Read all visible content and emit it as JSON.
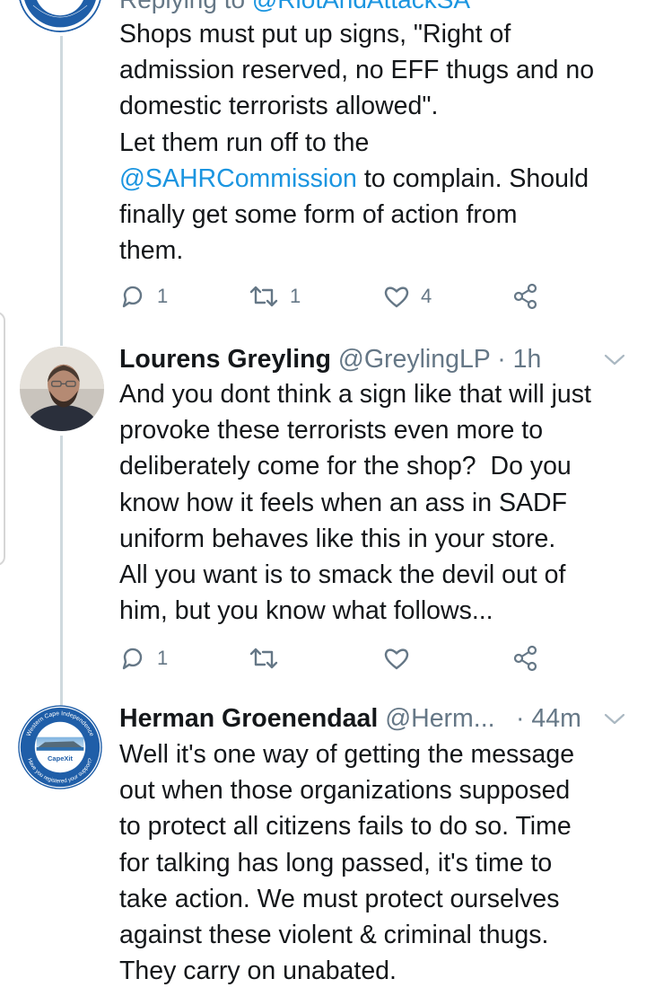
{
  "tweets": [
    {
      "reply_prefix": "Replying to ",
      "reply_handle": "@RiotAndAttackSA",
      "text_before_mention": "Shops must put up signs, \"Right of\nadmission reserved, no EFF thugs and no\ndomestic terrorists allowed\".\nLet them run off to the\n",
      "mention": "@SAHRCommission",
      "text_after_mention": " to complain. Should\nfinally get some form of action from\nthem.",
      "avatar_icon": "cape-independence-logo-icon",
      "replies": "1",
      "retweets": "1",
      "likes": "4"
    },
    {
      "name": "Lourens Greyling",
      "handle": "@GreylingLP",
      "separator": " · ",
      "time": "1h",
      "avatar_icon": "user-photo-avatar",
      "text": "And you dont think a sign like that will just\nprovoke these terrorists even more to\ndeliberately come for the shop?  Do you\nknow how it feels when an ass in SADF\nuniform behaves like this in your store.\nAll you want is to smack the devil out of\nhim, but you know what follows...",
      "replies": "1",
      "retweets": "",
      "likes": ""
    },
    {
      "name": "Herman Groenendaal",
      "handle": "@Herm...",
      "separator": " · ",
      "time": "44m",
      "avatar_icon": "cape-independence-logo-icon",
      "avatar_ring_text_top": "Western Cape Independence",
      "avatar_ring_text_bottom": "Have you registered your support?",
      "avatar_brand": "CapeXit",
      "text": "Well it's one way of getting the message\nout when those organizations supposed\nto protect all citizens fails to do so. Time\nfor talking has long passed, it's time to\ntake action. We must protect ourselves\nagainst these violent & criminal thugs.\nThey carry on unabated."
    }
  ],
  "colors": {
    "text": "#14171a",
    "muted": "#657786",
    "link": "#1b95e0",
    "thread_line": "#cfd9de",
    "logo_ring": "#1f5ea8"
  }
}
